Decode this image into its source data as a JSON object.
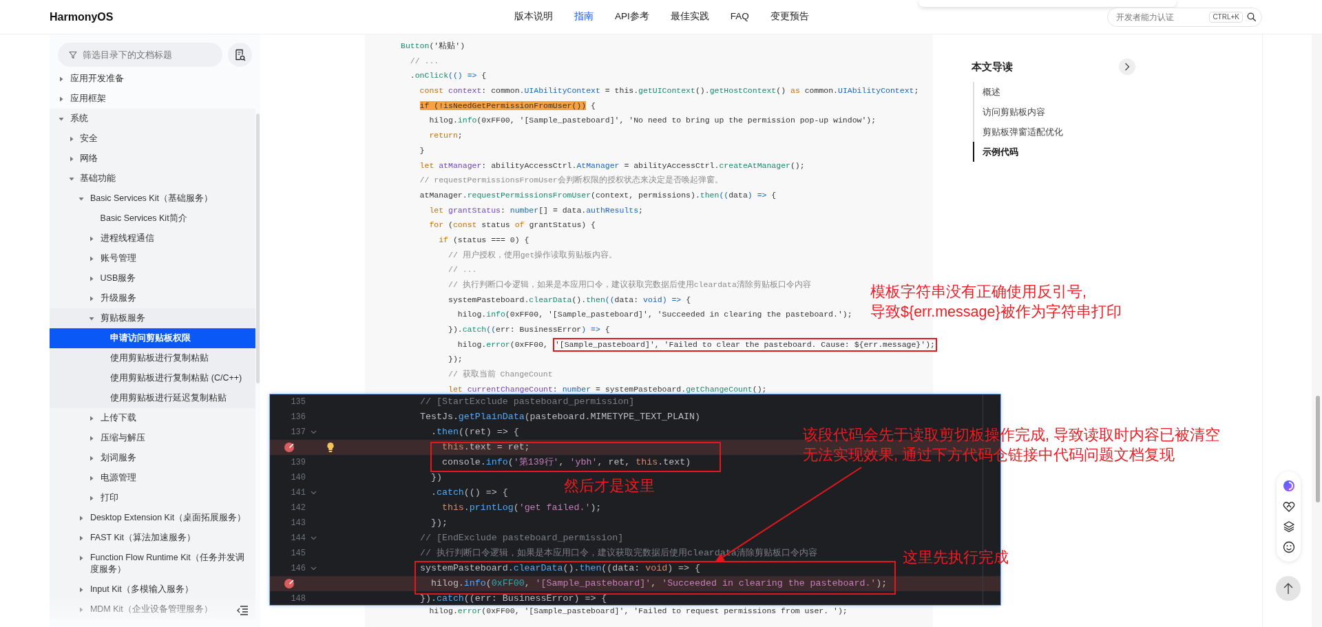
{
  "header": {
    "logo": "HarmonyOS",
    "nav": [
      {
        "label": "版本说明",
        "selected": false
      },
      {
        "label": "指南",
        "selected": true
      },
      {
        "label": "API参考",
        "selected": false
      },
      {
        "label": "最佳实践",
        "selected": false
      },
      {
        "label": "FAQ",
        "selected": false
      },
      {
        "label": "变更预告",
        "selected": false
      }
    ],
    "search": {
      "placeholder": "开发者能力认证",
      "shortcut": "CTRL+K"
    }
  },
  "sidebar": {
    "filter": {
      "placeholder": "筛选目录下的文档标题"
    },
    "tree": [
      {
        "label": "应用开发准备",
        "expanded": false,
        "selected": false
      },
      {
        "label": "应用框架",
        "expanded": false,
        "selected": false
      },
      {
        "label": "系统",
        "expanded": true,
        "selected": false,
        "children": [
          {
            "label": "安全",
            "expanded": false,
            "selected": false
          },
          {
            "label": "网络",
            "expanded": false,
            "selected": false
          },
          {
            "label": "基础功能",
            "expanded": true,
            "selected": false,
            "children": [
              {
                "label": "Basic Services Kit（基础服务）",
                "expanded": true,
                "selected": false,
                "children": [
                  {
                    "label": "Basic Services Kit简介",
                    "selected": false
                  },
                  {
                    "label": "进程线程通信",
                    "expanded": false,
                    "selected": false
                  },
                  {
                    "label": "账号管理",
                    "expanded": false,
                    "selected": false
                  },
                  {
                    "label": "USB服务",
                    "expanded": false,
                    "selected": false
                  },
                  {
                    "label": "升级服务",
                    "expanded": false,
                    "selected": false
                  },
                  {
                    "label": "剪贴板服务",
                    "expanded": true,
                    "selected": false,
                    "children": [
                      {
                        "label": "申请访问剪贴板权限",
                        "selected": true
                      },
                      {
                        "label": "使用剪贴板进行复制粘贴",
                        "selected": false
                      },
                      {
                        "label": "使用剪贴板进行复制粘贴 (C/C++)",
                        "selected": false
                      },
                      {
                        "label": "使用剪贴板进行延迟复制粘贴",
                        "selected": false
                      }
                    ]
                  },
                  {
                    "label": "上传下载",
                    "expanded": false,
                    "selected": false
                  },
                  {
                    "label": "压缩与解压",
                    "expanded": false,
                    "selected": false
                  },
                  {
                    "label": "划词服务",
                    "expanded": false,
                    "selected": false
                  },
                  {
                    "label": "电源管理",
                    "expanded": false,
                    "selected": false
                  },
                  {
                    "label": "打印",
                    "expanded": false,
                    "selected": false
                  }
                ]
              },
              {
                "label": "Desktop Extension Kit（桌面拓展服务）",
                "expanded": false,
                "selected": false
              },
              {
                "label": "FAST Kit（算法加速服务）",
                "expanded": false,
                "selected": false
              },
              {
                "label": "Function Flow Runtime Kit（任务并发调度服务）",
                "expanded": false,
                "selected": false
              },
              {
                "label": "Input Kit（多模输入服务）",
                "expanded": false,
                "selected": false
              },
              {
                "label": "MDM Kit（企业设备管理服务）",
                "expanded": false,
                "selected": false
              }
            ]
          }
        ]
      }
    ]
  },
  "code": {
    "lines": [
      {
        "tokens": [
          {
            "kind": "function",
            "text": "Button"
          },
          {
            "kind": "plain",
            "text": "('粘贴')"
          }
        ]
      },
      {
        "tokens": [
          {
            "kind": "comment",
            "text": "  // ..."
          }
        ]
      },
      {
        "tokens": [
          {
            "kind": "plain",
            "text": "  ."
          },
          {
            "kind": "function",
            "text": "onClick"
          },
          {
            "kind": "type",
            "text": "(() =>"
          },
          {
            "kind": "plain",
            "text": " {"
          }
        ]
      },
      {
        "tokens": [
          {
            "kind": "keyword",
            "text": "    const "
          },
          {
            "kind": "variable",
            "text": "context"
          },
          {
            "kind": "plain",
            "text": ": common."
          },
          {
            "kind": "type",
            "text": "UIAbilityContext"
          },
          {
            "kind": "plain",
            "text": " = this."
          },
          {
            "kind": "function",
            "text": "getUIContext"
          },
          {
            "kind": "plain",
            "text": "()."
          },
          {
            "kind": "function",
            "text": "getHostContext"
          },
          {
            "kind": "plain",
            "text": "() "
          },
          {
            "kind": "keyword",
            "text": "as"
          },
          {
            "kind": "plain",
            "text": " common."
          },
          {
            "kind": "type",
            "text": "UIAbilityContext"
          },
          {
            "kind": "plain",
            "text": ";"
          }
        ]
      },
      {
        "tokens": [
          {
            "kind": "highlight",
            "text": "    if (!isNeedGetPermissionFromUser())"
          },
          {
            "kind": "plain",
            "text": " {"
          }
        ]
      },
      {
        "tokens": [
          {
            "kind": "plain",
            "text": "      hilog."
          },
          {
            "kind": "function",
            "text": "info"
          },
          {
            "kind": "plain",
            "text": "(0xFF00, '[Sample_pasteboard]', 'No need to bring up the permission pop-up window');"
          }
        ]
      },
      {
        "tokens": [
          {
            "kind": "keyword",
            "text": "      return"
          },
          {
            "kind": "plain",
            "text": ";"
          }
        ]
      },
      {
        "tokens": [
          {
            "kind": "plain",
            "text": "    }"
          }
        ]
      },
      {
        "tokens": [
          {
            "kind": "keyword",
            "text": "    let "
          },
          {
            "kind": "variable",
            "text": "atManager"
          },
          {
            "kind": "plain",
            "text": ": abilityAccessCtrl."
          },
          {
            "kind": "type",
            "text": "AtManager"
          },
          {
            "kind": "plain",
            "text": " = abilityAccessCtrl."
          },
          {
            "kind": "function",
            "text": "createAtManager"
          },
          {
            "kind": "plain",
            "text": "();"
          }
        ]
      },
      {
        "tokens": [
          {
            "kind": "comment",
            "text": "    // requestPermissionsFromUser会判断权限的授权状态来决定是否唤起弹窗。"
          }
        ]
      },
      {
        "tokens": [
          {
            "kind": "plain",
            "text": "    atManager."
          },
          {
            "kind": "function",
            "text": "requestPermissionsFromUser"
          },
          {
            "kind": "plain",
            "text": "(context, permissions)."
          },
          {
            "kind": "function",
            "text": "then"
          },
          {
            "kind": "type",
            "text": "(("
          },
          {
            "kind": "plain",
            "text": "data"
          },
          {
            "kind": "type",
            "text": ") =>"
          },
          {
            "kind": "plain",
            "text": " {"
          }
        ]
      },
      {
        "tokens": [
          {
            "kind": "keyword",
            "text": "      let "
          },
          {
            "kind": "variable",
            "text": "grantStatus"
          },
          {
            "kind": "plain",
            "text": ": "
          },
          {
            "kind": "type",
            "text": "number"
          },
          {
            "kind": "plain",
            "text": "[] = data."
          },
          {
            "kind": "type",
            "text": "authResults"
          },
          {
            "kind": "plain",
            "text": ";"
          }
        ]
      },
      {
        "tokens": [
          {
            "kind": "keyword",
            "text": "      for"
          },
          {
            "kind": "plain",
            "text": " ("
          },
          {
            "kind": "keyword",
            "text": "const"
          },
          {
            "kind": "plain",
            "text": " status "
          },
          {
            "kind": "keyword",
            "text": "of"
          },
          {
            "kind": "plain",
            "text": " grantStatus) {"
          }
        ]
      },
      {
        "tokens": [
          {
            "kind": "keyword",
            "text": "        if"
          },
          {
            "kind": "plain",
            "text": " (status === 0) {"
          }
        ]
      },
      {
        "tokens": [
          {
            "kind": "comment",
            "text": "          // 用户授权，使用get操作读取剪贴板内容。"
          }
        ]
      },
      {
        "tokens": [
          {
            "kind": "comment",
            "text": "          // ..."
          }
        ]
      },
      {
        "tokens": [
          {
            "kind": "comment",
            "text": "          // 执行判断口令逻辑，如果是本应用口令，建议获取完数据后使用cleardata清除剪贴板口令内容"
          }
        ]
      },
      {
        "tokens": [
          {
            "kind": "plain",
            "text": "          systemPasteboard."
          },
          {
            "kind": "function",
            "text": "clearData"
          },
          {
            "kind": "plain",
            "text": "()."
          },
          {
            "kind": "function",
            "text": "then"
          },
          {
            "kind": "type",
            "text": "(("
          },
          {
            "kind": "plain",
            "text": "data: "
          },
          {
            "kind": "type",
            "text": "void) =>"
          },
          {
            "kind": "plain",
            "text": " {"
          }
        ]
      },
      {
        "tokens": [
          {
            "kind": "plain",
            "text": "            hilog."
          },
          {
            "kind": "function",
            "text": "info"
          },
          {
            "kind": "plain",
            "text": "(0xFF00, '[Sample_pasteboard]', 'Succeeded in clearing the pasteboard.');"
          }
        ]
      },
      {
        "tokens": [
          {
            "kind": "plain",
            "text": "          })."
          },
          {
            "kind": "function",
            "text": "catch"
          },
          {
            "kind": "type",
            "text": "(("
          },
          {
            "kind": "plain",
            "text": "err: BusinessError"
          },
          {
            "kind": "type",
            "text": ") =>"
          },
          {
            "kind": "plain",
            "text": " {"
          }
        ]
      },
      {
        "tokens": [
          {
            "kind": "plain",
            "text": "            hilog."
          },
          {
            "kind": "function",
            "text": "error"
          },
          {
            "kind": "plain",
            "text": "(0xFF00, "
          }
        ],
        "boxed_tokens": [
          {
            "kind": "plain",
            "text": "'[Sample_pasteboard]', 'Failed to clear the pasteboard. Cause: ${err.message}');"
          }
        ]
      },
      {
        "tokens": [
          {
            "kind": "plain",
            "text": "          });"
          }
        ]
      },
      {
        "tokens": [
          {
            "kind": "comment",
            "text": "          // 获取当前 ChangeCount"
          }
        ]
      },
      {
        "tokens": [
          {
            "kind": "keyword",
            "text": "          let "
          },
          {
            "kind": "variable",
            "text": "currentChangeCount"
          },
          {
            "kind": "plain",
            "text": ": "
          },
          {
            "kind": "type",
            "text": "number"
          },
          {
            "kind": "plain",
            "text": " = systemPasteboard."
          },
          {
            "kind": "function",
            "text": "getChangeCount"
          },
          {
            "kind": "plain",
            "text": "();"
          }
        ]
      }
    ],
    "lines_after": [
      {
        "tokens": [
          {
            "kind": "plain",
            "text": "      hilog."
          },
          {
            "kind": "function",
            "text": "error"
          },
          {
            "kind": "plain",
            "text": "(0xFF00, '[Sample_pasteboard]', 'Failed to request permissions from user. ');"
          }
        ]
      }
    ]
  },
  "editor_screenshot": {
    "lines": [
      {
        "number": "135",
        "fold": false,
        "breakpoint": false,
        "bulb": false,
        "tokens": [
          {
            "kind": "comment",
            "text": "// [StartExclude pasteboard_permission]"
          }
        ]
      },
      {
        "number": "136",
        "fold": false,
        "breakpoint": false,
        "bulb": false,
        "tokens": [
          {
            "kind": "plain",
            "text": "TestJs."
          },
          {
            "kind": "function",
            "text": "getPlainData"
          },
          {
            "kind": "plain",
            "text": "(pasteboard.MIMETYPE_TEXT_PLAIN)"
          }
        ]
      },
      {
        "number": "137",
        "fold": true,
        "breakpoint": false,
        "bulb": false,
        "tokens": [
          {
            "kind": "plain",
            "text": "  ."
          },
          {
            "kind": "function",
            "text": "then"
          },
          {
            "kind": "plain",
            "text": "((ret) => {"
          }
        ]
      },
      {
        "fold": false,
        "breakpoint": true,
        "bulb": true,
        "tokens": [
          {
            "kind": "keyword",
            "text": "    this"
          },
          {
            "kind": "plain",
            "text": ".text = ret;"
          }
        ]
      },
      {
        "number": "139",
        "fold": false,
        "breakpoint": false,
        "bulb": false,
        "tokens": [
          {
            "kind": "plain",
            "text": "    console."
          },
          {
            "kind": "function",
            "text": "info"
          },
          {
            "kind": "plain",
            "text": "("
          },
          {
            "kind": "string",
            "text": "'第139行'"
          },
          {
            "kind": "plain",
            "text": ", "
          },
          {
            "kind": "string",
            "text": "'ybh'"
          },
          {
            "kind": "plain",
            "text": ", ret, "
          },
          {
            "kind": "keyword",
            "text": "this"
          },
          {
            "kind": "plain",
            "text": ".text)"
          }
        ]
      },
      {
        "number": "140",
        "fold": false,
        "breakpoint": false,
        "bulb": false,
        "tokens": [
          {
            "kind": "plain",
            "text": "  })"
          }
        ]
      },
      {
        "number": "141",
        "fold": true,
        "breakpoint": false,
        "bulb": false,
        "tokens": [
          {
            "kind": "plain",
            "text": "  ."
          },
          {
            "kind": "function",
            "text": "catch"
          },
          {
            "kind": "plain",
            "text": "(() => {"
          }
        ]
      },
      {
        "number": "142",
        "fold": false,
        "breakpoint": false,
        "bulb": false,
        "tokens": [
          {
            "kind": "keyword",
            "text": "    this"
          },
          {
            "kind": "plain",
            "text": "."
          },
          {
            "kind": "function",
            "text": "printLog"
          },
          {
            "kind": "plain",
            "text": "("
          },
          {
            "kind": "string",
            "text": "'get failed.'"
          },
          {
            "kind": "plain",
            "text": ");"
          }
        ]
      },
      {
        "number": "143",
        "fold": false,
        "breakpoint": false,
        "bulb": false,
        "tokens": [
          {
            "kind": "plain",
            "text": "  });"
          }
        ]
      },
      {
        "number": "144",
        "fold": true,
        "breakpoint": false,
        "bulb": false,
        "tokens": [
          {
            "kind": "comment",
            "text": "// [EndExclude pasteboard_permission]"
          }
        ]
      },
      {
        "number": "145",
        "fold": false,
        "breakpoint": false,
        "bulb": false,
        "tokens": [
          {
            "kind": "comment",
            "text": "// 执行判断口令逻辑，如果是本应用口令，建议获取完数据后使用cleardata清除剪贴板口令内容"
          }
        ]
      },
      {
        "number": "146",
        "fold": true,
        "breakpoint": false,
        "bulb": false,
        "tokens": [
          {
            "kind": "plain",
            "text": "systemPasteboard."
          },
          {
            "kind": "function",
            "text": "clearData"
          },
          {
            "kind": "plain",
            "text": "()."
          },
          {
            "kind": "function",
            "text": "then"
          },
          {
            "kind": "plain",
            "text": "((data: "
          },
          {
            "kind": "keyword",
            "text": "void"
          },
          {
            "kind": "plain",
            "text": ") => {"
          }
        ]
      },
      {
        "fold": false,
        "breakpoint": true,
        "bulb": false,
        "tokens": [
          {
            "kind": "plain",
            "text": "  hilog."
          },
          {
            "kind": "function",
            "text": "info"
          },
          {
            "kind": "plain",
            "text": "("
          },
          {
            "kind": "number",
            "text": "0xFF00"
          },
          {
            "kind": "plain",
            "text": ", "
          },
          {
            "kind": "string",
            "text": "'[Sample_pasteboard]'"
          },
          {
            "kind": "plain",
            "text": ", "
          },
          {
            "kind": "string",
            "text": "'Succeeded in clearing the pasteboard.'"
          },
          {
            "kind": "plain",
            "text": ");"
          }
        ]
      },
      {
        "number": "148",
        "fold": false,
        "breakpoint": false,
        "bulb": false,
        "tokens": [
          {
            "kind": "plain",
            "text": "})."
          },
          {
            "kind": "function",
            "text": "catch"
          },
          {
            "kind": "plain",
            "text": "((err: BusinessError) => {"
          }
        ]
      }
    ]
  },
  "annotations": [
    {
      "lines": [
        "模板字符串没有正确使用反引号,",
        "导致${err.message}被作为字符串打印"
      ]
    },
    {
      "lines": [
        "该段代码会先于读取剪切板操作完成, 导致读取时内容已被清空",
        "无法实现效果, 通过下方代码仓链接中代码问题文档复现"
      ]
    },
    {
      "lines": [
        "然后才是这里"
      ]
    },
    {
      "lines": [
        "这里先执行完成"
      ]
    }
  ],
  "toc": {
    "title": "本文导读",
    "items": [
      {
        "label": "概述",
        "selected": false
      },
      {
        "label": "访问剪贴板内容",
        "selected": false
      },
      {
        "label": "剪贴板弹窗适配优化",
        "selected": false
      },
      {
        "label": "示例代码",
        "selected": true
      }
    ]
  }
}
